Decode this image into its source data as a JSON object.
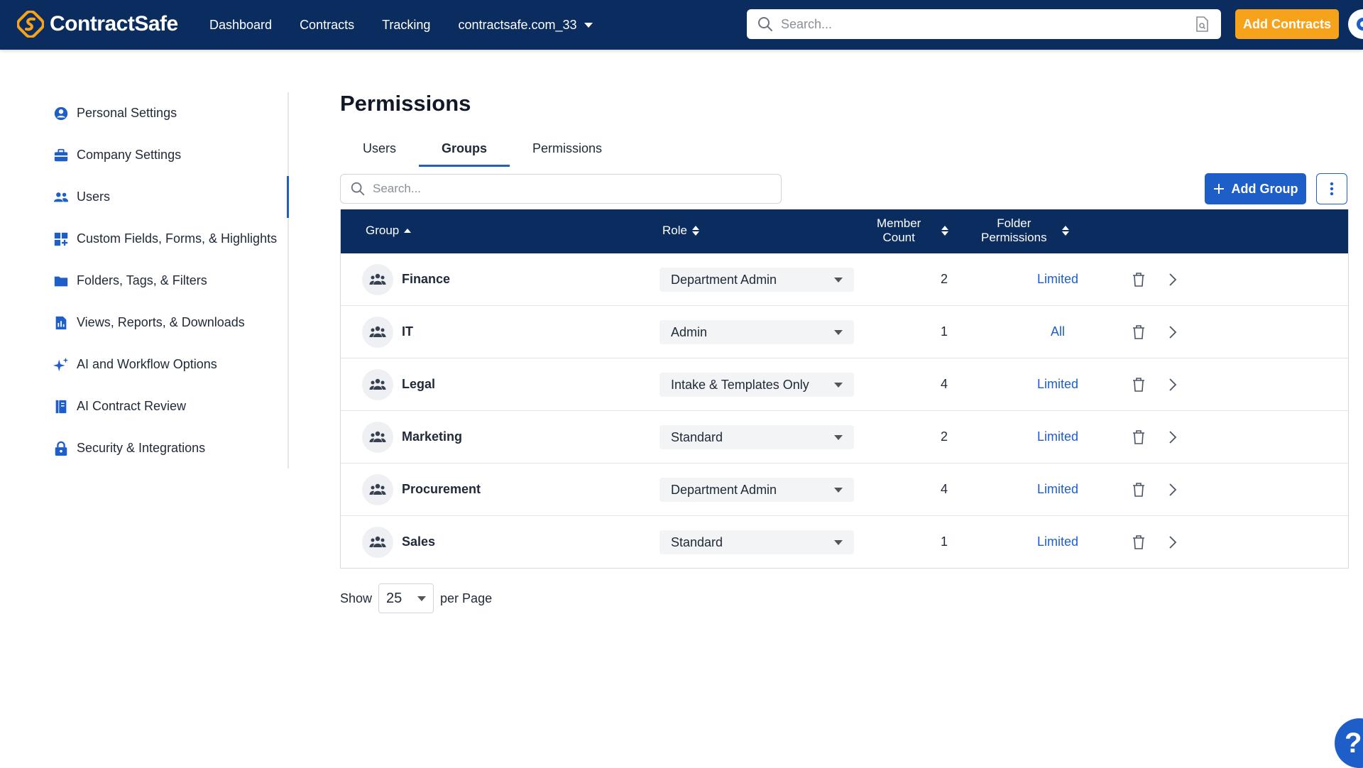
{
  "brand": {
    "name": "ContractSafe",
    "accent": "#f7a21b",
    "navy": "#0b2c5f",
    "blue": "#1e5ec8"
  },
  "nav": {
    "items": [
      {
        "label": "Dashboard"
      },
      {
        "label": "Contracts"
      },
      {
        "label": "Tracking"
      },
      {
        "label": "contractsafe.com_33"
      }
    ],
    "search_placeholder": "Search...",
    "add_contracts_label": "Add Contracts"
  },
  "sidebar": {
    "items": [
      {
        "label": "Personal Settings",
        "icon": "user-circle-icon"
      },
      {
        "label": "Company Settings",
        "icon": "briefcase-icon"
      },
      {
        "label": "Users",
        "icon": "users-icon",
        "active": true
      },
      {
        "label": "Custom Fields, Forms, & Highlights",
        "icon": "grid-plus-icon"
      },
      {
        "label": "Folders, Tags, & Filters",
        "icon": "folder-icon"
      },
      {
        "label": "Views, Reports, & Downloads",
        "icon": "report-icon"
      },
      {
        "label": "AI and Workflow Options",
        "icon": "sparkle-icon"
      },
      {
        "label": "AI Contract Review",
        "icon": "book-icon"
      },
      {
        "label": "Security & Integrations",
        "icon": "lock-icon"
      }
    ]
  },
  "page": {
    "title": "Permissions"
  },
  "tabs": [
    {
      "label": "Users"
    },
    {
      "label": "Groups",
      "active": true
    },
    {
      "label": "Permissions"
    }
  ],
  "groups_search_placeholder": "Search...",
  "add_group_label": "Add Group",
  "table": {
    "headers": {
      "group": "Group",
      "role": "Role",
      "member_count_1": "Member",
      "member_count_2": "Count",
      "folder_perm_1": "Folder",
      "folder_perm_2": "Permissions"
    },
    "rows": [
      {
        "group": "Finance",
        "role": "Department Admin",
        "count": "2",
        "folder": "Limited"
      },
      {
        "group": "IT",
        "role": "Admin",
        "count": "1",
        "folder": "All"
      },
      {
        "group": "Legal",
        "role": "Intake & Templates Only",
        "count": "4",
        "folder": "Limited"
      },
      {
        "group": "Marketing",
        "role": "Standard",
        "count": "2",
        "folder": "Limited"
      },
      {
        "group": "Procurement",
        "role": "Department Admin",
        "count": "4",
        "folder": "Limited"
      },
      {
        "group": "Sales",
        "role": "Standard",
        "count": "1",
        "folder": "Limited"
      }
    ]
  },
  "pager": {
    "show": "Show",
    "per_page_value": "25",
    "per_page": "per Page"
  },
  "help": {
    "label": "?"
  }
}
